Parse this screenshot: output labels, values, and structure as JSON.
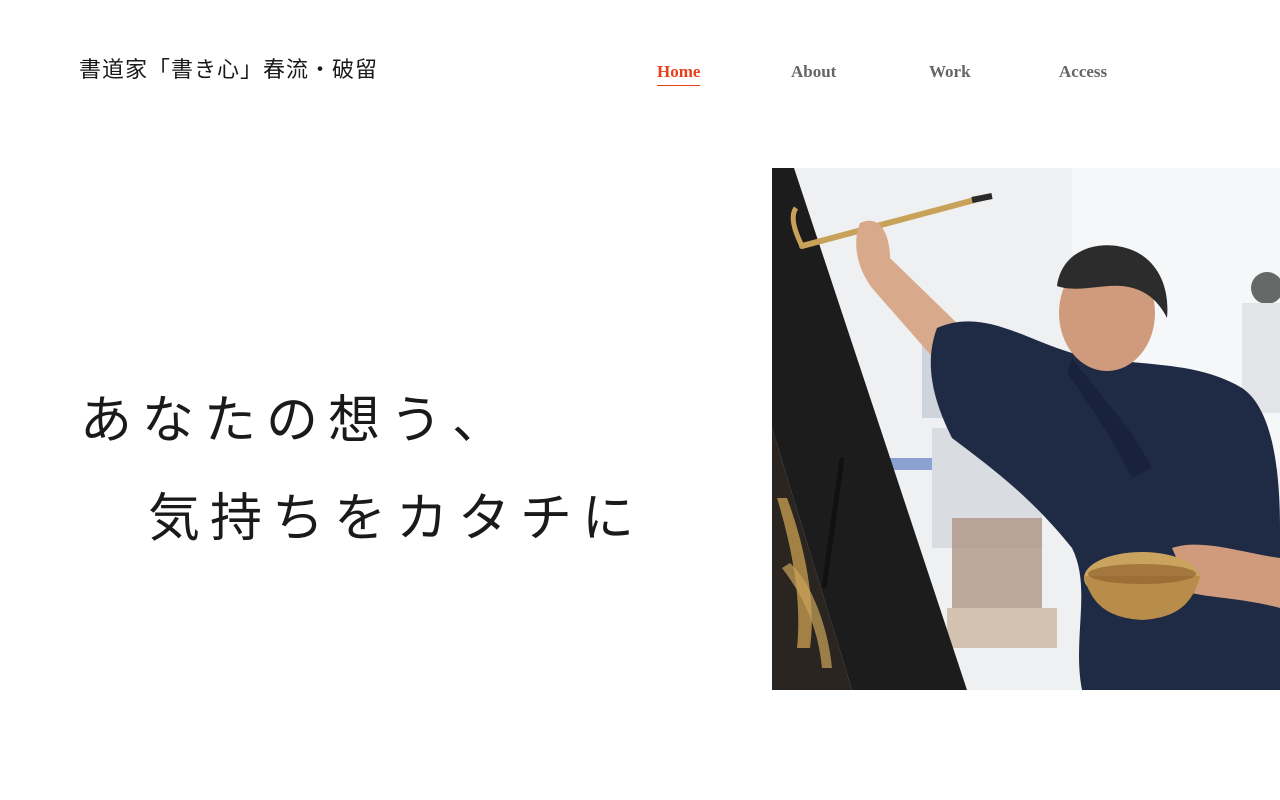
{
  "header": {
    "site_title": "書道家「書き心」春流・破留"
  },
  "nav": {
    "items": [
      {
        "label": "Home",
        "active": true
      },
      {
        "label": "About",
        "active": false
      },
      {
        "label": "Work",
        "active": false
      },
      {
        "label": "Access",
        "active": false
      }
    ]
  },
  "hero": {
    "line1": "あなたの想う、",
    "line2": "気持ちをカタチに"
  },
  "colors": {
    "accent": "#e8401c",
    "nav_text": "#666666",
    "text": "#1a1a1a",
    "background": "#ffffff"
  }
}
